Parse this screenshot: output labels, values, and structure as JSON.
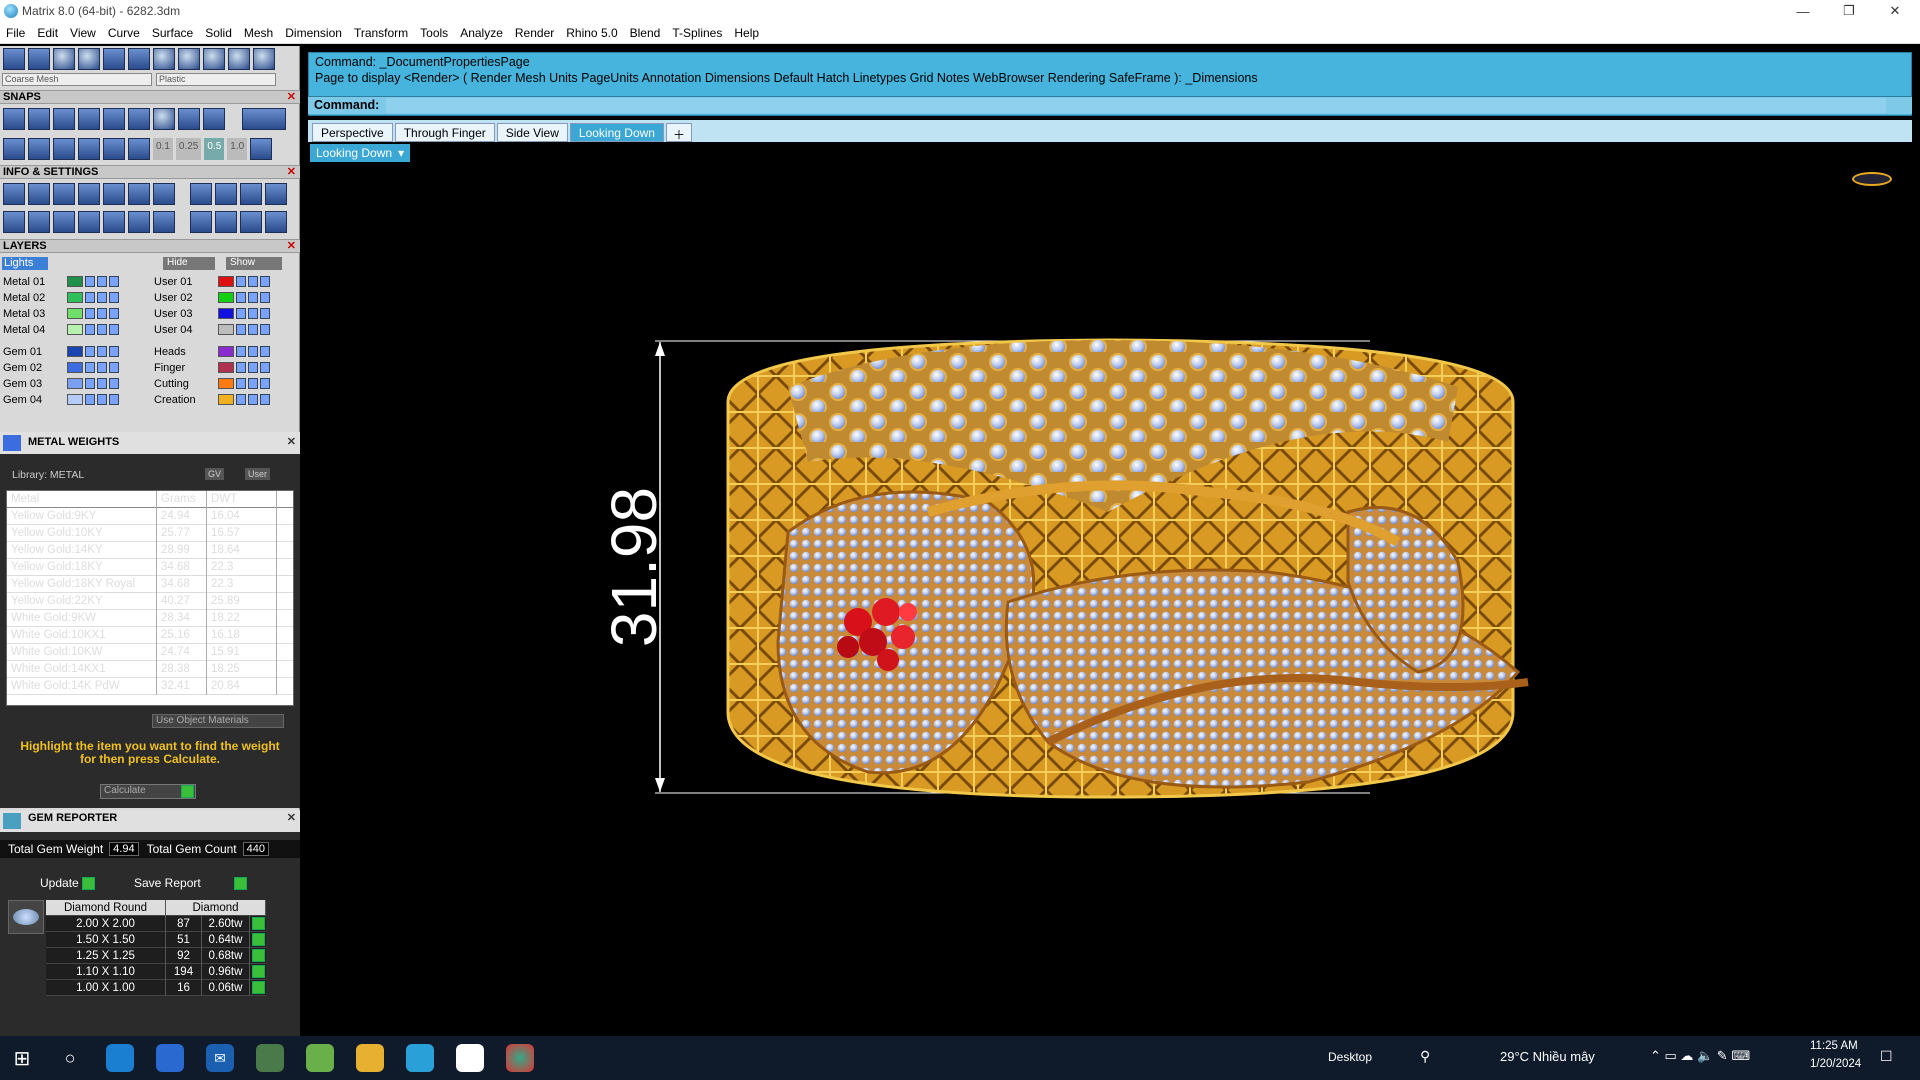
{
  "window": {
    "title": "Matrix 8.0 (64-bit) - 6282.3dm",
    "minimize": "—",
    "restore": "❐",
    "close": "✕"
  },
  "menu": [
    "File",
    "Edit",
    "View",
    "Curve",
    "Surface",
    "Solid",
    "Mesh",
    "Dimension",
    "Transform",
    "Tools",
    "Analyze",
    "Render",
    "Rhino 5.0",
    "Blend",
    "T-Splines",
    "Help"
  ],
  "toolbar": {
    "mesh_select": "Coarse Mesh",
    "material_select": "Plastic"
  },
  "snaps": {
    "title": "SNAPS",
    "values": [
      "0.1",
      "0.25",
      "0.5",
      "1.0"
    ]
  },
  "info_settings": {
    "title": "INFO & SETTINGS"
  },
  "layers": {
    "title": "LAYERS",
    "lights": "Lights",
    "hide": "Hide",
    "show": "Show",
    "left": [
      {
        "name": "Metal 01",
        "color": "#1f8f4a"
      },
      {
        "name": "Metal 02",
        "color": "#2fbf5a"
      },
      {
        "name": "Metal 03",
        "color": "#6fdf6a"
      },
      {
        "name": "Metal 04",
        "color": "#b8f0b0"
      },
      {
        "name": "Gem 01",
        "color": "#1844b0"
      },
      {
        "name": "Gem 02",
        "color": "#3b6ce0"
      },
      {
        "name": "Gem 03",
        "color": "#79a0f0"
      },
      {
        "name": "Gem 04",
        "color": "#b4ccf7"
      }
    ],
    "right": [
      {
        "name": "User 01",
        "color": "#e01010"
      },
      {
        "name": "User 02",
        "color": "#10d010"
      },
      {
        "name": "User 03",
        "color": "#1010e0"
      },
      {
        "name": "User 04",
        "color": "#bdbdbd"
      },
      {
        "name": "Heads",
        "color": "#8a2bd0"
      },
      {
        "name": "Finger",
        "color": "#b03050"
      },
      {
        "name": "Cutting",
        "color": "#ff7a10"
      },
      {
        "name": "Creation",
        "color": "#f0b020"
      }
    ]
  },
  "metal_weights": {
    "title": "METAL WEIGHTS",
    "library": "Library: METAL",
    "gv": "GV",
    "user": "User",
    "headers": [
      "Metal",
      "Grams",
      "DWT"
    ],
    "rows": [
      [
        "Yellow Gold:9KY",
        "24.94",
        "16.04"
      ],
      [
        "Yellow Gold:10KY",
        "25.77",
        "16.57"
      ],
      [
        "Yellow Gold:14KY",
        "28.99",
        "18.64"
      ],
      [
        "Yellow Gold:18KY",
        "34.68",
        "22.3"
      ],
      [
        "Yellow Gold:18KY Royal",
        "34.68",
        "22.3"
      ],
      [
        "Yellow Gold:22KY",
        "40.27",
        "25.89"
      ],
      [
        "White Gold:9KW",
        "28.34",
        "18.22"
      ],
      [
        "White Gold:10KX1",
        "25.16",
        "16.18"
      ],
      [
        "White Gold:10KW",
        "24.74",
        "15.91"
      ],
      [
        "White Gold:14KX1",
        "28.38",
        "18.25"
      ],
      [
        "White Gold:14K PdW",
        "32.41",
        "20.84"
      ]
    ],
    "use_object_materials": "Use Object Materials",
    "hint": "Highlight the item you want to find the weight for then press Calculate.",
    "calculate": "Calculate"
  },
  "gem_reporter": {
    "title": "GEM REPORTER",
    "total_weight_label": "Total Gem Weight",
    "total_weight": "4.94",
    "total_count_label": "Total Gem Count",
    "total_count": "440",
    "update": "Update",
    "save_report": "Save Report",
    "headers": [
      "Diamond Round",
      "Diamond"
    ],
    "rows": [
      [
        "2.00 X 2.00",
        "87",
        "2.60tw"
      ],
      [
        "1.50 X 1.50",
        "51",
        "0.64tw"
      ],
      [
        "1.25 X 1.25",
        "92",
        "0.68tw"
      ],
      [
        "1.10 X 1.10",
        "194",
        "0.96tw"
      ],
      [
        "1.00 X 1.00",
        "16",
        "0.06tw"
      ]
    ]
  },
  "command": {
    "line1": "Command: _DocumentPropertiesPage",
    "line2": "Page to display <Render> ( Render  Mesh  Units  PageUnits  Annotation  Dimensions  Default  Hatch  Linetypes  Grid  Notes  WebBrowser  Rendering  SafeFrame ): _Dimensions",
    "prompt": "Command:"
  },
  "tabs": [
    "Perspective",
    "Through Finger",
    "Side View",
    "Looking Down"
  ],
  "active_tab": "Looking Down",
  "viewport": {
    "name": "Looking Down",
    "dimension": "31.98"
  },
  "taskbar": {
    "desktop": "Desktop",
    "weather": "29°C  Nhiều mây",
    "time": "11:25 AM",
    "date": "1/20/2024"
  }
}
